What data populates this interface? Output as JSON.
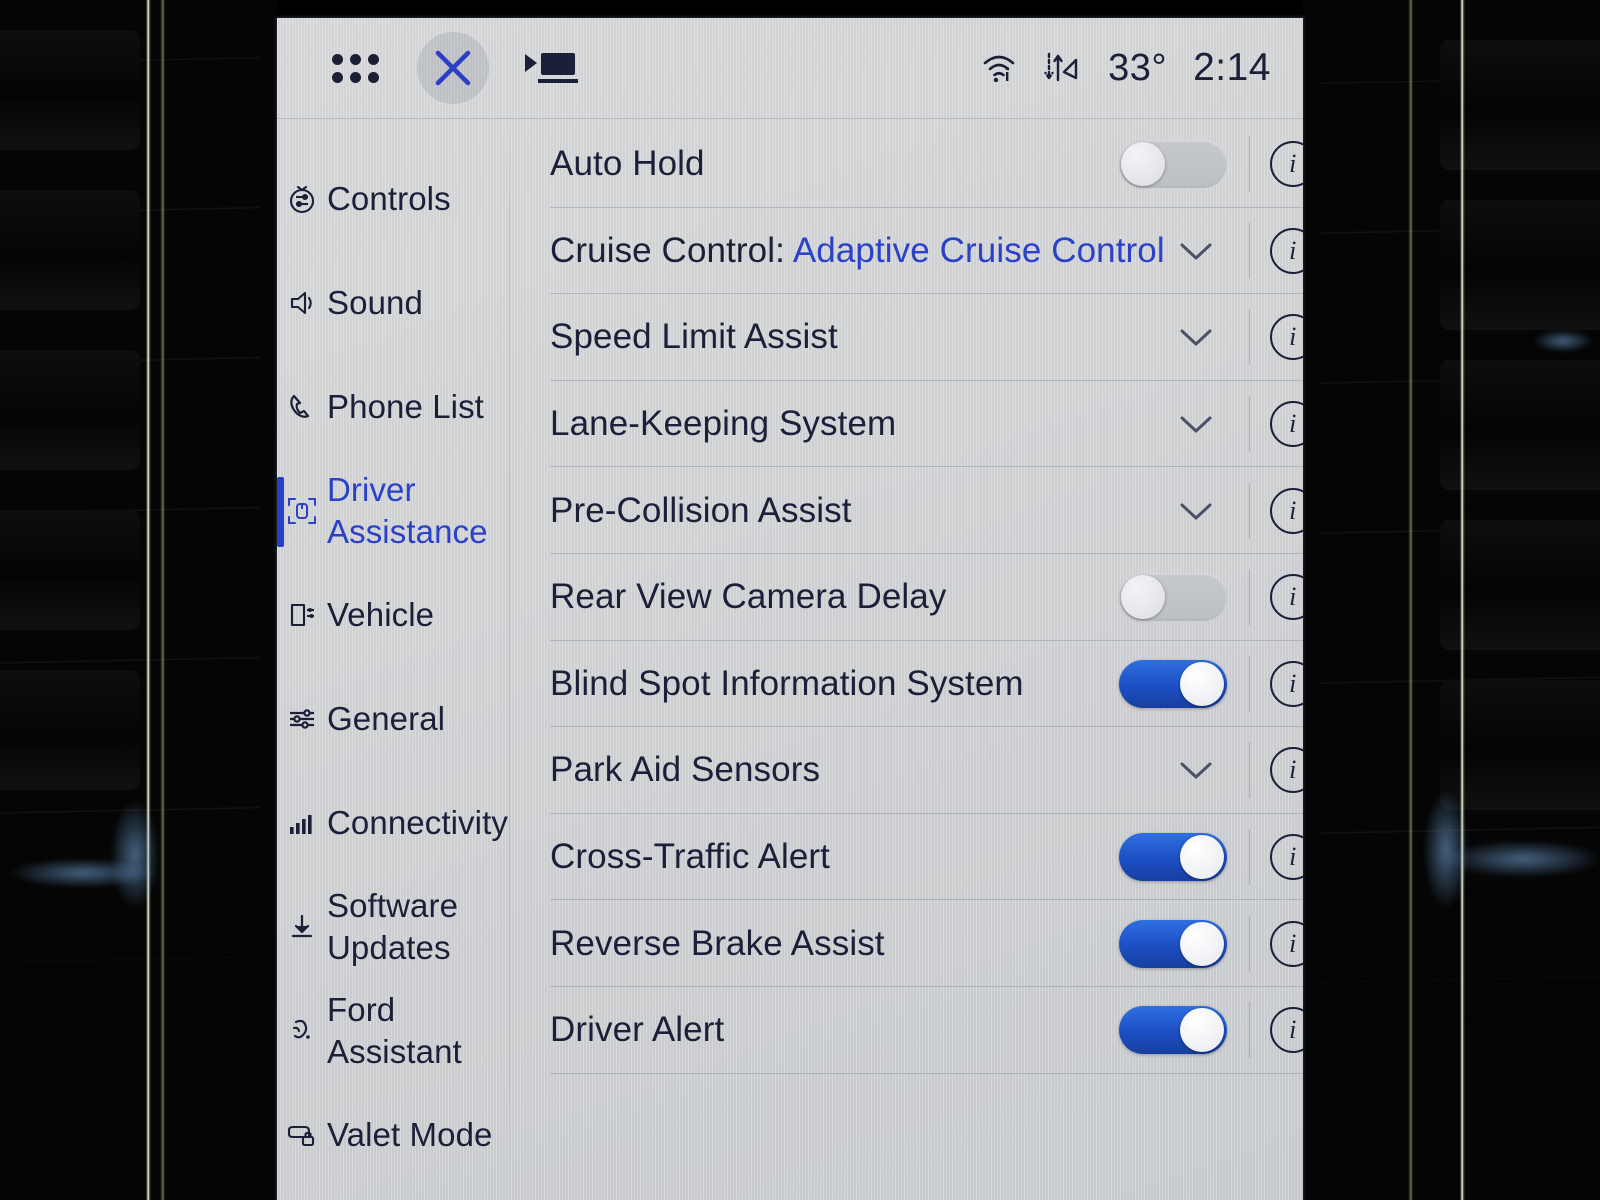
{
  "statusbar": {
    "apps_icon": "app-grid-icon",
    "close_icon": "close-x-icon",
    "display_icon": "display-projection-icon",
    "wifi_icon": "wifi-icon",
    "data_icon": "data-transfer-icon",
    "temperature": "33°",
    "time": "2:14"
  },
  "sidebar": {
    "items": [
      {
        "label": "Controls",
        "icon": "controls-dial-icon",
        "active": false,
        "two_line": false
      },
      {
        "label": "Sound",
        "icon": "speaker-icon",
        "active": false,
        "two_line": false
      },
      {
        "label": "Phone List",
        "icon": "phone-handset-icon",
        "active": false,
        "two_line": false
      },
      {
        "label": "Driver Assistance",
        "icon": "driver-assistance-icon",
        "active": true,
        "two_line": true
      },
      {
        "label": "Vehicle",
        "icon": "vehicle-icon",
        "active": false,
        "two_line": false
      },
      {
        "label": "General",
        "icon": "sliders-icon",
        "active": false,
        "two_line": false
      },
      {
        "label": "Connectivity",
        "icon": "signal-bars-icon",
        "active": false,
        "two_line": false
      },
      {
        "label": "Software Updates",
        "icon": "download-icon",
        "active": false,
        "two_line": true
      },
      {
        "label": "Ford Assistant",
        "icon": "assistant-icon",
        "active": false,
        "two_line": true
      },
      {
        "label": "Valet Mode",
        "icon": "valet-lock-icon",
        "active": false,
        "two_line": false
      }
    ]
  },
  "list": {
    "rows": [
      {
        "label": "Auto Hold",
        "value": "",
        "control": "toggle",
        "state": "off",
        "info": true
      },
      {
        "label": "Cruise Control:",
        "value": "Adaptive Cruise Control",
        "control": "chevron",
        "state": "",
        "info": true
      },
      {
        "label": "Speed Limit Assist",
        "value": "",
        "control": "chevron",
        "state": "",
        "info": true
      },
      {
        "label": "Lane-Keeping System",
        "value": "",
        "control": "chevron",
        "state": "",
        "info": true
      },
      {
        "label": "Pre-Collision Assist",
        "value": "",
        "control": "chevron",
        "state": "",
        "info": true
      },
      {
        "label": "Rear View Camera Delay",
        "value": "",
        "control": "toggle",
        "state": "off",
        "info": true
      },
      {
        "label": "Blind Spot Information System",
        "value": "",
        "control": "toggle",
        "state": "on",
        "info": true
      },
      {
        "label": "Park Aid Sensors",
        "value": "",
        "control": "chevron",
        "state": "",
        "info": true
      },
      {
        "label": "Cross-Traffic Alert",
        "value": "",
        "control": "toggle",
        "state": "on",
        "info": true
      },
      {
        "label": "Reverse Brake Assist",
        "value": "",
        "control": "toggle",
        "state": "on",
        "info": true
      },
      {
        "label": "Driver Alert",
        "value": "",
        "control": "toggle",
        "state": "on",
        "info": true
      }
    ],
    "info_glyph": "i"
  },
  "colors": {
    "accent_blue": "#2b41c8",
    "toggle_on": "#1c4fc4",
    "text": "#1b2038",
    "screen_bg": "#d2d4d6"
  }
}
